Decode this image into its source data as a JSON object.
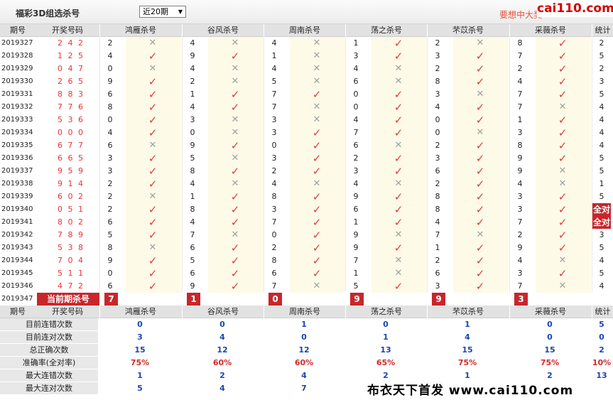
{
  "topbar": {
    "title": "福彩3D组选杀号",
    "period_select": "近20期",
    "promo": "要想中大奖",
    "logo": "cai110.com"
  },
  "headers": {
    "period": "期号",
    "draw": "开奖号码",
    "experts": [
      "鸿雁杀号",
      "谷风杀号",
      "周南杀号",
      "荡之杀号",
      "芣苡杀号",
      "采薇杀号"
    ],
    "total": "统计"
  },
  "rows": [
    {
      "period": "2019327",
      "nums": "2 4 2",
      "kills": [
        "2",
        "4",
        "4",
        "1",
        "2",
        "8"
      ],
      "ok": [
        false,
        false,
        false,
        true,
        false,
        true
      ],
      "total": "2"
    },
    {
      "period": "2019328",
      "nums": "1 2 5",
      "kills": [
        "4",
        "9",
        "1",
        "3",
        "3",
        "7"
      ],
      "ok": [
        true,
        true,
        false,
        true,
        true,
        true
      ],
      "total": "5"
    },
    {
      "period": "2019329",
      "nums": "0 4 7",
      "kills": [
        "0",
        "4",
        "4",
        "4",
        "2",
        "2"
      ],
      "ok": [
        false,
        false,
        false,
        false,
        true,
        true
      ],
      "total": "2"
    },
    {
      "period": "2019330",
      "nums": "2 6 5",
      "kills": [
        "9",
        "2",
        "5",
        "6",
        "8",
        "4"
      ],
      "ok": [
        true,
        false,
        false,
        false,
        true,
        true
      ],
      "total": "3"
    },
    {
      "period": "2019331",
      "nums": "8 8 3",
      "kills": [
        "6",
        "1",
        "7",
        "0",
        "3",
        "7"
      ],
      "ok": [
        true,
        true,
        true,
        true,
        false,
        true
      ],
      "total": "5"
    },
    {
      "period": "2019332",
      "nums": "7 7 6",
      "kills": [
        "8",
        "4",
        "7",
        "0",
        "4",
        "7"
      ],
      "ok": [
        true,
        true,
        false,
        true,
        true,
        false
      ],
      "total": "4"
    },
    {
      "period": "2019333",
      "nums": "5 3 6",
      "kills": [
        "0",
        "3",
        "3",
        "4",
        "0",
        "1"
      ],
      "ok": [
        true,
        false,
        false,
        true,
        true,
        true
      ],
      "total": "4"
    },
    {
      "period": "2019334",
      "nums": "0 0 0",
      "kills": [
        "4",
        "0",
        "3",
        "7",
        "0",
        "3"
      ],
      "ok": [
        true,
        false,
        true,
        true,
        false,
        true
      ],
      "total": "4"
    },
    {
      "period": "2019335",
      "nums": "6 7 7",
      "kills": [
        "6",
        "9",
        "0",
        "6",
        "2",
        "8"
      ],
      "ok": [
        false,
        true,
        true,
        false,
        true,
        true
      ],
      "total": "4"
    },
    {
      "period": "2019336",
      "nums": "6 6 5",
      "kills": [
        "3",
        "5",
        "3",
        "2",
        "3",
        "9"
      ],
      "ok": [
        true,
        false,
        true,
        true,
        true,
        true
      ],
      "total": "5"
    },
    {
      "period": "2019337",
      "nums": "9 5 9",
      "kills": [
        "3",
        "8",
        "2",
        "3",
        "6",
        "9"
      ],
      "ok": [
        true,
        true,
        true,
        true,
        true,
        false
      ],
      "total": "5"
    },
    {
      "period": "2019338",
      "nums": "9 1 4",
      "kills": [
        "2",
        "4",
        "4",
        "4",
        "2",
        "4"
      ],
      "ok": [
        true,
        false,
        false,
        false,
        true,
        false
      ],
      "total": "1"
    },
    {
      "period": "2019339",
      "nums": "6 0 2",
      "kills": [
        "2",
        "1",
        "8",
        "9",
        "8",
        "3"
      ],
      "ok": [
        false,
        true,
        true,
        true,
        true,
        true
      ],
      "total": "5"
    },
    {
      "period": "2019340",
      "nums": "0 5 1",
      "kills": [
        "2",
        "8",
        "3",
        "6",
        "8",
        "3"
      ],
      "ok": [
        true,
        true,
        true,
        true,
        true,
        true
      ],
      "total": "全对"
    },
    {
      "period": "2019341",
      "nums": "8 0 2",
      "kills": [
        "6",
        "4",
        "7",
        "1",
        "4",
        "7"
      ],
      "ok": [
        true,
        true,
        true,
        true,
        true,
        true
      ],
      "total": "全对"
    },
    {
      "period": "2019342",
      "nums": "7 8 9",
      "kills": [
        "5",
        "7",
        "0",
        "9",
        "7",
        "2"
      ],
      "ok": [
        true,
        false,
        true,
        false,
        false,
        true
      ],
      "total": "3"
    },
    {
      "period": "2019343",
      "nums": "5 3 8",
      "kills": [
        "8",
        "6",
        "2",
        "9",
        "1",
        "9"
      ],
      "ok": [
        false,
        true,
        true,
        true,
        true,
        true
      ],
      "total": "5"
    },
    {
      "period": "2019344",
      "nums": "7 0 4",
      "kills": [
        "9",
        "5",
        "8",
        "7",
        "2",
        "4"
      ],
      "ok": [
        true,
        true,
        true,
        false,
        true,
        false
      ],
      "total": "4"
    },
    {
      "period": "2019345",
      "nums": "5 1 1",
      "kills": [
        "0",
        "6",
        "6",
        "1",
        "6",
        "3"
      ],
      "ok": [
        true,
        true,
        true,
        false,
        true,
        true
      ],
      "total": "5"
    },
    {
      "period": "2019346",
      "nums": "4 7 2",
      "kills": [
        "6",
        "9",
        "7",
        "5",
        "3",
        "7"
      ],
      "ok": [
        true,
        true,
        false,
        true,
        true,
        false
      ],
      "total": "4"
    }
  ],
  "current": {
    "period": "2019347",
    "label": "当前期杀号",
    "kills": [
      "7",
      "1",
      "0",
      "9",
      "9",
      "3"
    ]
  },
  "stats": {
    "labels": [
      "目前连错次数",
      "目前连对次数",
      "总正确次数",
      "准确率(全对率)",
      "最大连错次数",
      "最大连对次数"
    ],
    "rows": [
      {
        "values": [
          "0",
          "0",
          "1",
          "0",
          "1",
          "0"
        ],
        "total": "5"
      },
      {
        "values": [
          "3",
          "4",
          "0",
          "1",
          "4",
          "0"
        ],
        "total": "0"
      },
      {
        "values": [
          "15",
          "12",
          "12",
          "13",
          "15",
          "15"
        ],
        "total": "2"
      },
      {
        "values": [
          "75%",
          "60%",
          "60%",
          "65%",
          "75%",
          "75%"
        ],
        "total": "10%"
      },
      {
        "values": [
          "1",
          "2",
          "4",
          "2",
          "1",
          "2"
        ],
        "total": "13"
      },
      {
        "values": [
          "5",
          "4",
          "7",
          "",
          "",
          ""
        ],
        "total": ""
      }
    ]
  },
  "watermark": "布衣天下首发 www.cai110.com"
}
